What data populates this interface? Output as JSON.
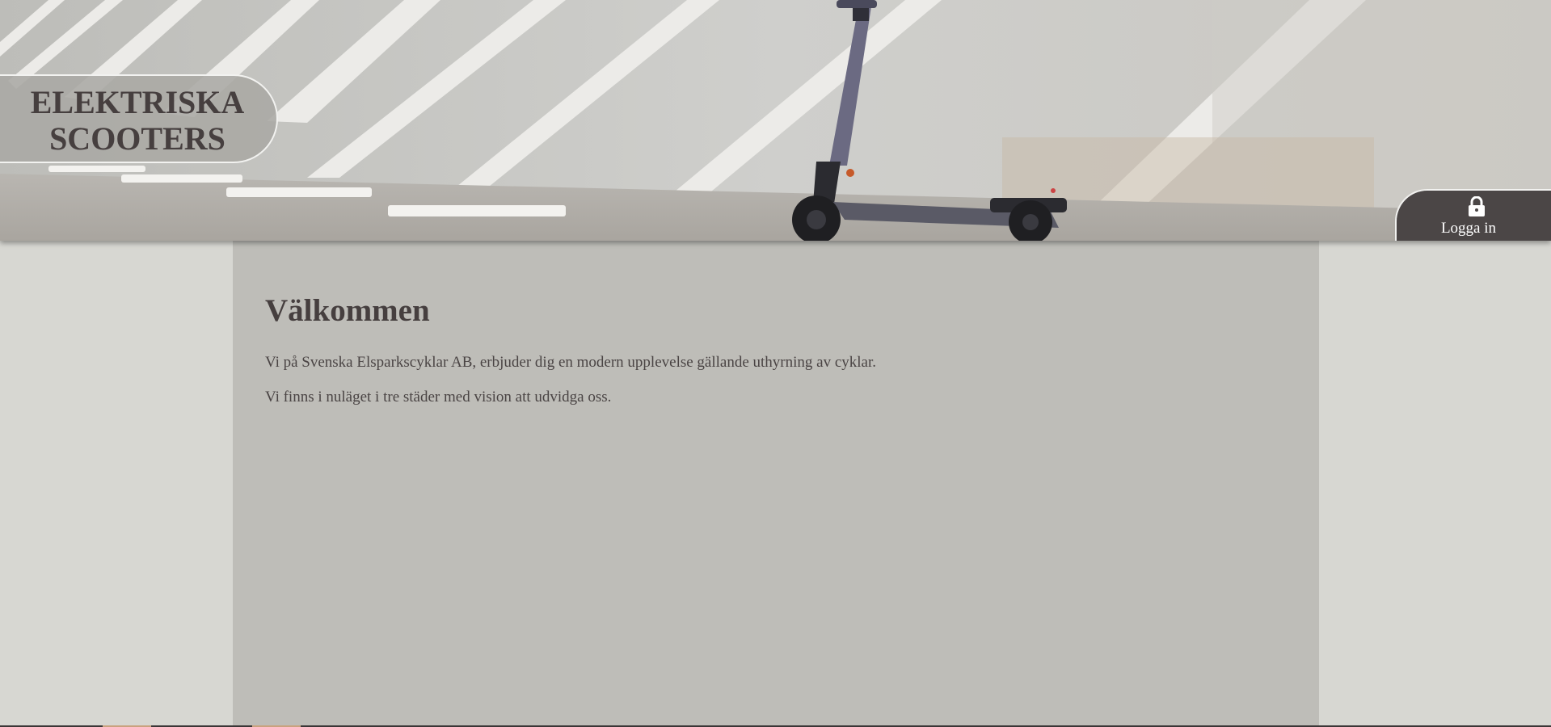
{
  "header": {
    "logo_line1": "ELEKTRISKA",
    "logo_line2": "SCOOTERS",
    "login_label": "Logga in",
    "login_icon": "lock-icon",
    "hero_image": "scooter-hero-image"
  },
  "main": {
    "heading": "Välkommen",
    "paragraph1": "Vi på Svenska Elsparkscyklar AB, erbjuder dig en modern upplevelse gällande uthyrning av cyklar.",
    "paragraph2": "Vi finns i nuläget i tre städer med vision att udvidga oss."
  },
  "colors": {
    "page_background": "#d7d7d2",
    "content_background": "#bebdb8",
    "text": "#463f3f",
    "login_background": "#4b4646"
  }
}
